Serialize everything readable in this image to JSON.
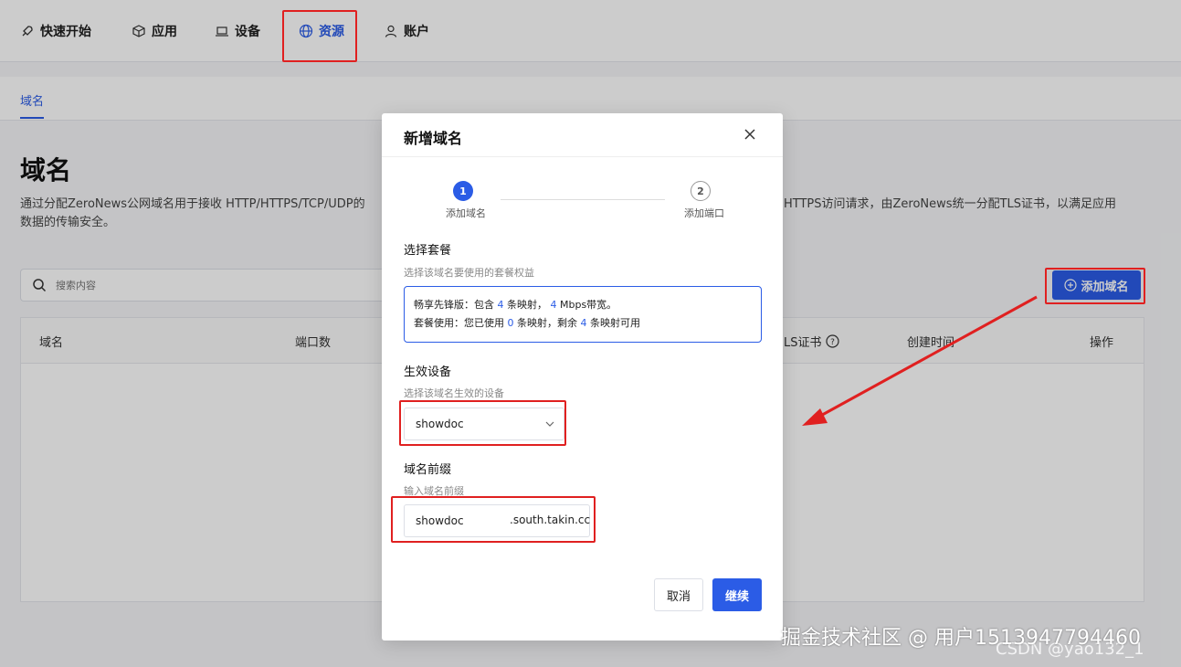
{
  "nav": {
    "items": [
      {
        "label": "快速开始",
        "icon": "rocket-icon"
      },
      {
        "label": "应用",
        "icon": "cube-icon"
      },
      {
        "label": "设备",
        "icon": "laptop-icon"
      },
      {
        "label": "资源",
        "icon": "globe-icon",
        "active": true
      },
      {
        "label": "账户",
        "icon": "user-icon"
      }
    ]
  },
  "subnav": {
    "active_tab": "域名"
  },
  "page": {
    "title": "域名",
    "desc_left": "通过分配ZeroNews公网域名用于接收 HTTP/HTTPS/TCP/UDP的",
    "desc_left_2": "数据的传输安全。",
    "desc_right": "HTTPS访问请求，由ZeroNews统一分配TLS证书，以满足应用"
  },
  "search": {
    "placeholder": "搜索内容"
  },
  "add_button": {
    "label": "添加域名"
  },
  "table": {
    "headers": [
      "域名",
      "端口数",
      "LS证书",
      "创建时间",
      "操作"
    ]
  },
  "modal": {
    "title": "新增域名",
    "steps": [
      {
        "num": "1",
        "label": "添加域名"
      },
      {
        "num": "2",
        "label": "添加端口"
      }
    ],
    "plan": {
      "title": "选择套餐",
      "subtitle": "选择该域名要使用的套餐权益",
      "line1_a": "畅享先锋版：包含",
      "line1_n1": "4",
      "line1_b": "条映射，",
      "line1_n2": "4",
      "line1_c": "Mbps带宽。",
      "line2_a": "套餐使用：您已使用",
      "line2_n1": "0",
      "line2_b": "条映射，剩余",
      "line2_n2": "4",
      "line2_c": "条映射可用"
    },
    "device": {
      "title": "生效设备",
      "subtitle": "选择该域名生效的设备",
      "value": "showdoc"
    },
    "prefix": {
      "title": "域名前缀",
      "subtitle": "输入域名前缀",
      "value": "showdoc",
      "suffix": ".south.takin.cc"
    },
    "cancel_label": "取消",
    "next_label": "继续"
  },
  "watermark": {
    "text1": "掘金技术社区 @ 用户1513947794460",
    "text2": "CSDN @yao132_1"
  }
}
